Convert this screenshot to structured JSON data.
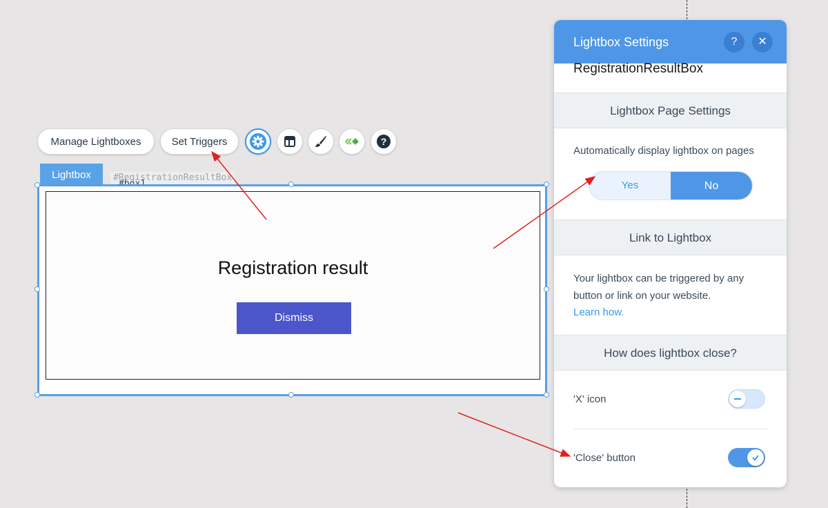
{
  "toolbar": {
    "manage_label": "Manage Lightboxes",
    "triggers_label": "Set Triggers",
    "icons": [
      "settings-gear-icon",
      "layout-icon",
      "design-brush-icon",
      "animation-icon",
      "help-icon"
    ]
  },
  "canvas": {
    "tab_label": "Lightbox",
    "element_id": "#RegistrationResultBox",
    "inner_id": "#box1",
    "title": "Registration result",
    "dismiss_label": "Dismiss"
  },
  "panel": {
    "title": "Lightbox Settings",
    "help_glyph": "?",
    "close_glyph": "✕",
    "lightbox_name": "RegistrationResultBox",
    "page_settings": {
      "heading": "Lightbox Page Settings",
      "auto_label": "Automatically display lightbox on pages",
      "yes": "Yes",
      "no": "No",
      "selected": "No"
    },
    "link": {
      "heading": "Link to Lightbox",
      "line1": "Your lightbox can be triggered by any",
      "line2": "button or link on your website.",
      "learn": "Learn how."
    },
    "close": {
      "heading": "How does lightbox close?",
      "x_icon_label": "'X' icon",
      "x_icon_on": false,
      "close_button_label": "'Close' button",
      "close_button_on": true
    }
  },
  "colors": {
    "accent": "#4f97e6",
    "dismiss": "#4a56c9",
    "arrow": "#e02020"
  }
}
